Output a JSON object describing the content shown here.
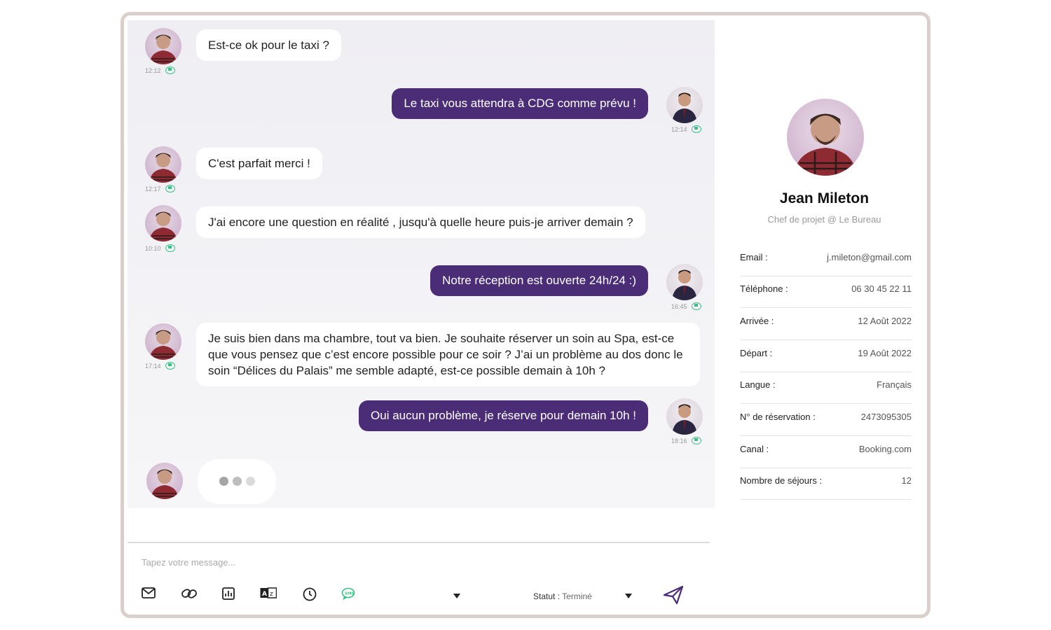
{
  "messages": [
    {
      "dir": "in",
      "text": "Est-ce ok pour le taxi ?",
      "time": "12:12"
    },
    {
      "dir": "out",
      "text": "Le taxi vous attendra à CDG comme prévu !",
      "time": "12:14"
    },
    {
      "dir": "in",
      "text": "C'est parfait merci !",
      "time": "12:17"
    },
    {
      "dir": "in",
      "text": "J'ai encore une question en réalité , jusqu'à quelle heure puis-je arriver demain ?",
      "time": "10:10"
    },
    {
      "dir": "out",
      "text": "Notre réception est ouverte 24h/24 :)",
      "time": "16:45"
    },
    {
      "dir": "in",
      "text": "Je suis bien dans ma chambre, tout va bien. Je souhaite réserver un soin au Spa, est-ce que vous pensez que c’est encore possible pour ce soir ? J’ai un problème au dos donc le soin “Délices du Palais” me semble adapté, est-ce possible demain à 10h ?",
      "time": "17:14"
    },
    {
      "dir": "out",
      "text": "Oui aucun problème, je réserve pour demain 10h !",
      "time": "18:16"
    }
  ],
  "composer": {
    "placeholder": "Tapez votre message...",
    "statut_label": "Statut :",
    "statut_value": "Terminé"
  },
  "profile": {
    "name": "Jean Mileton",
    "role": "Chef de projet @ Le Bureau",
    "fields": [
      {
        "label": "Email  :",
        "value": "j.mileton@gmail.com"
      },
      {
        "label": "Téléphone  :",
        "value": "06 30 45 22 11"
      },
      {
        "label": "Arrivée  :",
        "value": "12 Août 2022"
      },
      {
        "label": "Départ :",
        "value": "19 Août 2022"
      },
      {
        "label": "Langue :",
        "value": "Français"
      },
      {
        "label": "N° de réservation :",
        "value": "2473095305"
      },
      {
        "label": "Canal :",
        "value": "Booking.com"
      },
      {
        "label": "Nombre de séjours :",
        "value": "12"
      }
    ]
  },
  "colors": {
    "accent": "#4b2d77",
    "sms": "#3cbf86",
    "frame": "#d9cfcc"
  },
  "icons": [
    "mail-icon",
    "link-icon",
    "chart-icon",
    "translate-icon",
    "clock-icon",
    "sms-icon",
    "send-icon"
  ]
}
